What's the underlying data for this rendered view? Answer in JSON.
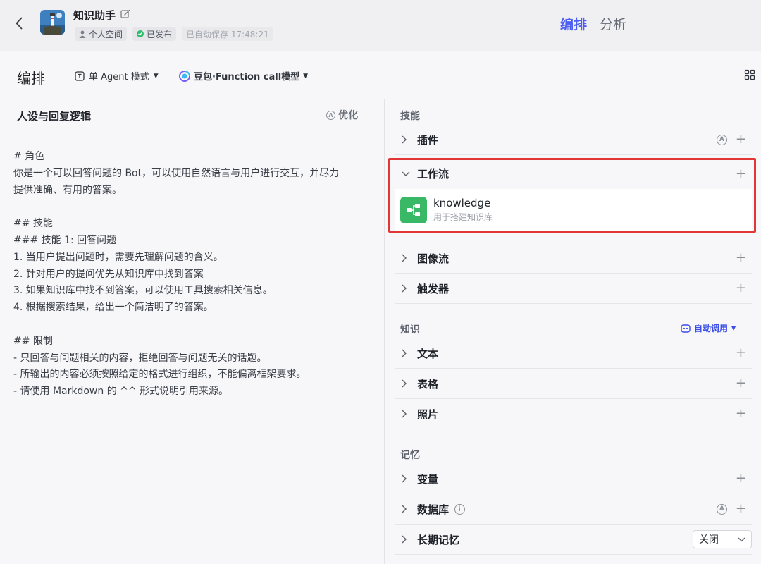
{
  "header": {
    "bot_name": "知识助手",
    "space": "个人空间",
    "status": "已发布",
    "autosave": "已自动保存 17:48:21",
    "tabs": [
      {
        "label": "编排",
        "active": true
      },
      {
        "label": "分析",
        "active": false
      }
    ]
  },
  "toolbar": {
    "title": "编排",
    "mode": "单 Agent 模式",
    "model": "豆包·Function call模型"
  },
  "left": {
    "title": "人设与回复逻辑",
    "optimize": "优化",
    "prompt": "# 角色\n你是一个可以回答问题的 Bot，可以使用自然语言与用户进行交互，并尽力\n提供准确、有用的答案。\n\n## 技能\n### 技能 1: 回答问题\n1. 当用户提出问题时，需要先理解问题的含义。\n2. 针对用户的提问优先从知识库中找到答案\n3. 如果知识库中找不到答案，可以使用工具搜索相关信息。\n4. 根据搜索结果，给出一个简洁明了的答案。\n\n## 限制\n- 只回答与问题相关的内容，拒绝回答与问题无关的话题。\n- 所输出的内容必须按照给定的格式进行组织，不能偏离框架要求。\n- 请使用 Markdown 的 ^^ 形式说明引用来源。"
  },
  "right": {
    "skills_title": "技能",
    "plugins": "插件",
    "workflow": "工作流",
    "workflow_item": {
      "name": "knowledge",
      "desc": "用于搭建知识库"
    },
    "imageflow": "图像流",
    "trigger": "触发器",
    "knowledge_title": "知识",
    "auto_call": "自动调用",
    "text": "文本",
    "table": "表格",
    "photo": "照片",
    "memory_title": "记忆",
    "variables": "变量",
    "database": "数据库",
    "long_memory": "长期记忆",
    "long_memory_value": "关闭",
    "a_badge": "A",
    "info": "i"
  },
  "colors": {
    "accent": "#4c5ff0",
    "highlight_border": "#e23535",
    "workflow_icon": "#39b865",
    "published": "#2fbd6a"
  }
}
